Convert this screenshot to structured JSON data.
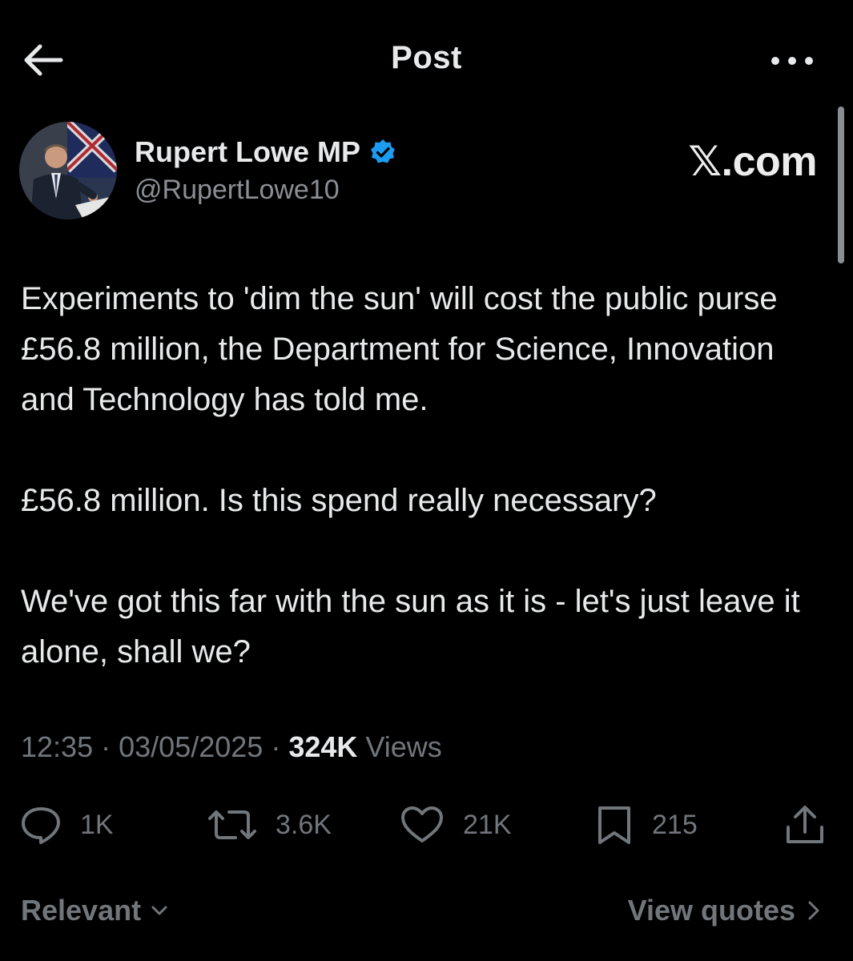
{
  "header": {
    "title": "Post",
    "back_icon": "arrow-left-icon",
    "more_icon": "more-horizontal-icon"
  },
  "author": {
    "display_name": "Rupert Lowe MP",
    "handle": "@RupertLowe10",
    "verified": true,
    "verified_color": "#1d9bf0"
  },
  "watermark": "𝕏.com",
  "post": {
    "paragraphs": [
      "Experiments to 'dim the sun' will cost the public purse £56.8 million, the Department for Science, Innovation and Technology has told me.",
      "£56.8 million. Is this spend really necessary?",
      "We've got this far with the sun as it is - let's just leave it alone, shall we?"
    ]
  },
  "meta": {
    "time": "12:35",
    "separator": "·",
    "date": "03/05/2025",
    "views_count": "324K",
    "views_label": "Views"
  },
  "actions": {
    "replies": "1K",
    "reposts": "3.6K",
    "likes": "21K",
    "bookmarks": "215"
  },
  "footer": {
    "sort_label": "Relevant",
    "quotes_label": "View quotes"
  },
  "colors": {
    "background": "#000000",
    "text_primary": "#e7e9ea",
    "text_secondary": "#71767b",
    "accent": "#1d9bf0"
  }
}
